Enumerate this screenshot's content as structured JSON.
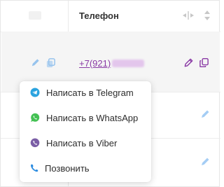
{
  "table": {
    "column_phone_header": "Телефон",
    "row": {
      "phone_prefix": "+7(921)",
      "phone_hidden": "●●●-●●-●●"
    }
  },
  "context_menu": {
    "items": [
      {
        "label": "Написать в Telegram",
        "icon": "telegram-icon",
        "color": "#2aa3df"
      },
      {
        "label": "Написать в WhatsApp",
        "icon": "whatsapp-icon",
        "color": "#44c154"
      },
      {
        "label": "Написать в Viber",
        "icon": "viber-icon",
        "color": "#7b5ea6"
      },
      {
        "label": "Позвонить",
        "icon": "phone-icon",
        "color": "#2a8be0"
      }
    ]
  },
  "colors": {
    "link": "#8a3aa5",
    "accent_blue": "#2f8fe6",
    "row_hover": "#f5f5f5"
  }
}
